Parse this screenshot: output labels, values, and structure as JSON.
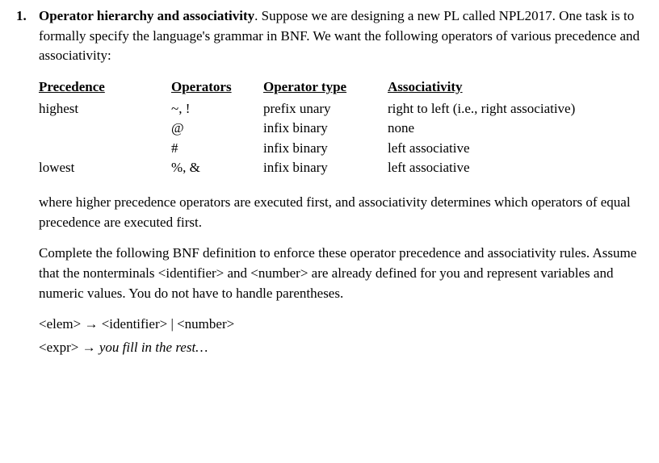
{
  "question": {
    "number": "1.",
    "title": "Operator hierarchy and associativity",
    "intro_after_title": ".   Suppose we are designing a new PL called NPL2017.  One task is to formally specify the language's grammar in BNF.  We want the following operators of various precedence and associativity:"
  },
  "table": {
    "headers": {
      "precedence": "Precedence ",
      "operators": "Operators",
      "operator_type": "Operator type",
      "associativity": "Associativity"
    },
    "rows": [
      {
        "precedence": "highest",
        "operators": "~, !",
        "operator_type": "prefix unary",
        "associativity": "right to left (i.e., right associative)"
      },
      {
        "precedence": "",
        "operators": "@",
        "operator_type": "infix binary",
        "associativity": "none"
      },
      {
        "precedence": "",
        "operators": "#",
        "operator_type": "infix binary",
        "associativity": "left associative"
      },
      {
        "precedence": "lowest",
        "operators": "%, &",
        "operator_type": "infix binary",
        "associativity": "left associative"
      }
    ]
  },
  "para2": "where higher precedence operators are executed first, and associativity determines which operators of equal precedence are executed first.",
  "para3": "Complete the following BNF definition to enforce these operator precedence and associativity rules.  Assume that the nonterminals <identifier> and <number> are already defined for you and represent variables and numeric values.  You do not have to handle parentheses.",
  "bnf": {
    "line1": "<elem> → <identifier> | <number>",
    "line2_prefix": "<expr> → ",
    "line2_fill": "you fill in the rest…"
  }
}
